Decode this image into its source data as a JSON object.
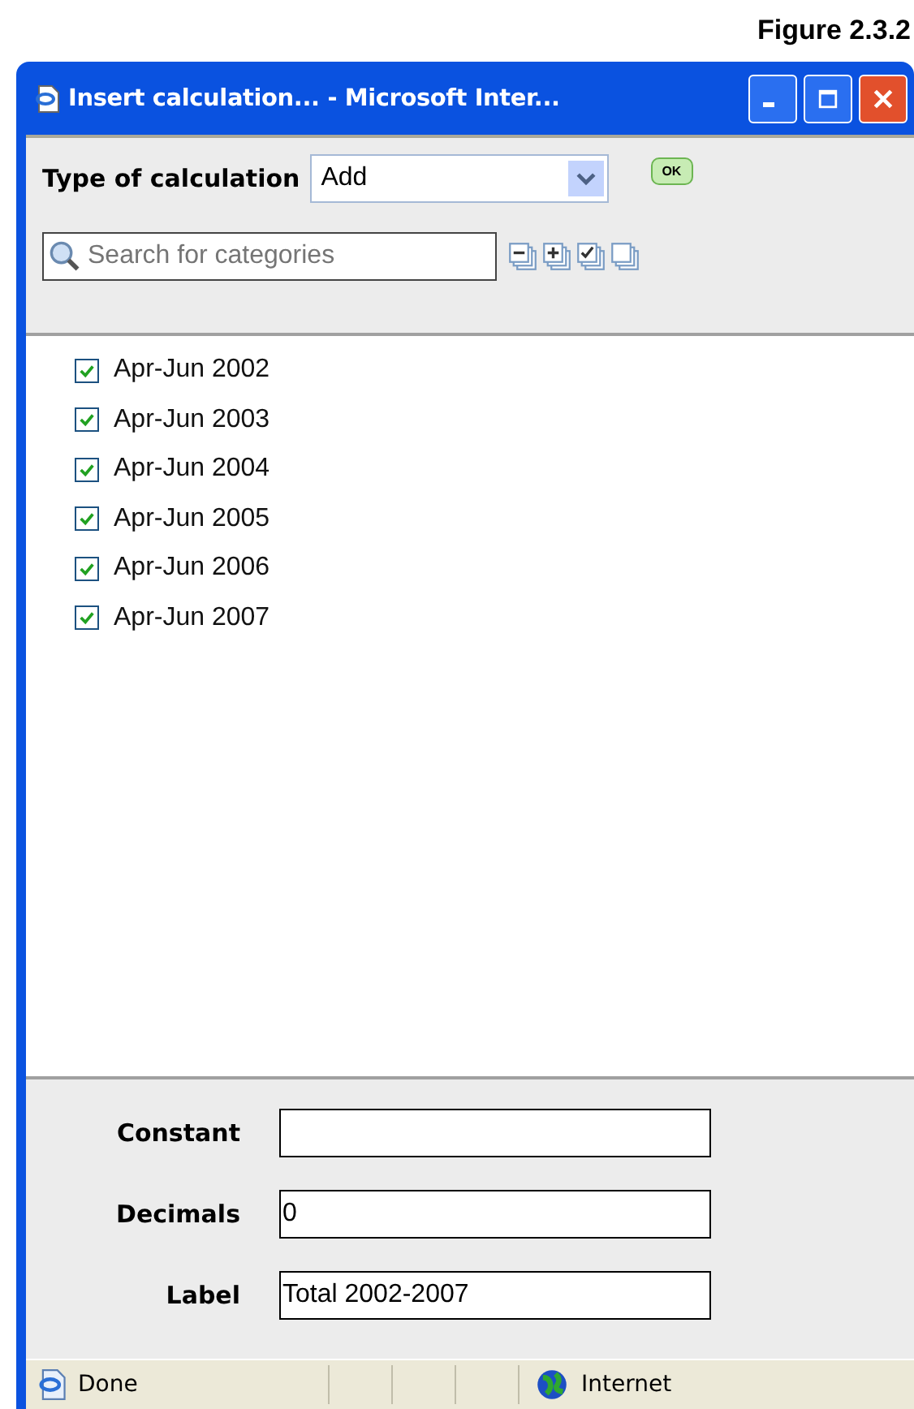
{
  "figure_caption": "Figure 2.3.2",
  "window": {
    "title": "Insert calculation... - Microsoft Inter..."
  },
  "calculation_type": {
    "label": "Type of calculation",
    "value": "Add",
    "ok_button": "OK"
  },
  "search": {
    "placeholder": "Search for categories"
  },
  "categories": [
    {
      "label": "Apr-Jun 2002",
      "checked": true
    },
    {
      "label": "Apr-Jun 2003",
      "checked": true
    },
    {
      "label": "Apr-Jun 2004",
      "checked": true
    },
    {
      "label": "Apr-Jun 2005",
      "checked": true
    },
    {
      "label": "Apr-Jun 2006",
      "checked": true
    },
    {
      "label": "Apr-Jun 2007",
      "checked": true
    }
  ],
  "fields": [
    {
      "label": "Constant"
    },
    {
      "label": "Decimals",
      "value": "0"
    },
    {
      "label": "Label",
      "value": "Total 2002-2007"
    }
  ],
  "status_bar": {
    "status": "Done",
    "zone": "Internet"
  }
}
